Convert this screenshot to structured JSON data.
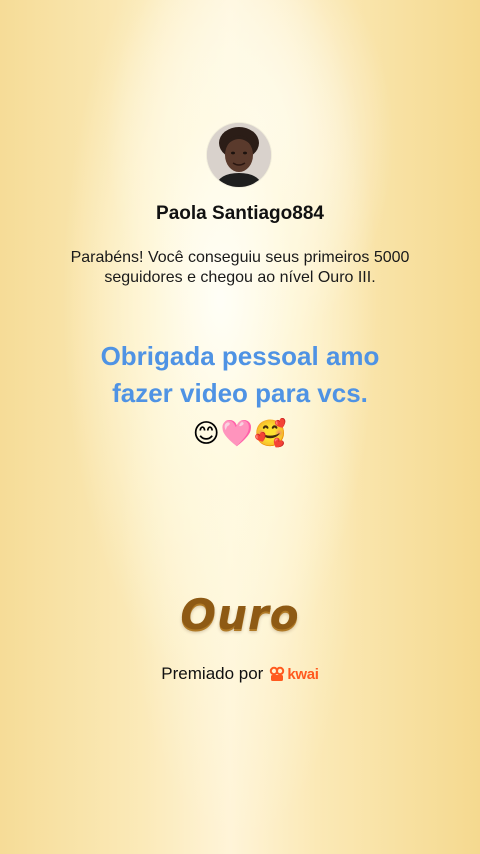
{
  "profile": {
    "username": "Paola Santiago884",
    "avatar_icon": "profile-photo"
  },
  "achievement": {
    "message": "Parabéns! Você conseguiu seus primeiros 5000 seguidores e chegou ao nível Ouro III.",
    "level_name": "Ouro"
  },
  "caption": {
    "line1": "Obrigada pessoal amo",
    "line2": "fazer video para vcs.",
    "emojis": "😊🩷🥰"
  },
  "footer": {
    "awarded_by_label": "Premiado por",
    "brand_name": "kwai",
    "brand_icon": "kwai-logo-icon"
  },
  "colors": {
    "caption_blue": "#4f93e4",
    "gold_text": "#8e5a14",
    "kwai_orange": "#ff5a1f"
  }
}
